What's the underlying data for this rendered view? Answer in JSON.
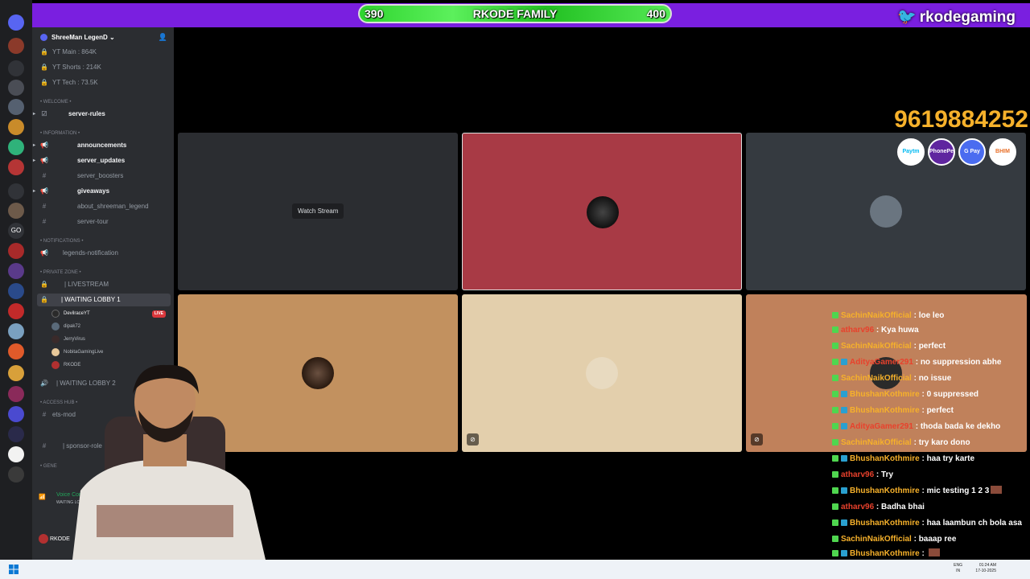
{
  "overlay": {
    "goal_current": "390",
    "goal_title": "RKODE FAMILY",
    "goal_target": "400",
    "brand": "rkodegaming",
    "phone": "9619884252",
    "payments": [
      "Paytm",
      "PhonePe",
      "G Pay",
      "BHIM"
    ]
  },
  "server": {
    "name": "ShreeMan LegenD",
    "stats": [
      "YT Main : 864K",
      "YT Shorts : 214K",
      "YT Tech : 73.5K"
    ]
  },
  "channels": {
    "cat_welcome": "• WELCOME •",
    "server_rules": "server-rules",
    "cat_information": "• INFORMATION •",
    "announcements": "announcements",
    "server_updates": "server_updates",
    "server_boosters": "server_boosters",
    "giveaways": "giveaways",
    "about": "about_shreeman_legend",
    "server_tour": "server-tour",
    "cat_notifications": "• NOTIFICATIONS •",
    "legends_notification": "legends-notification",
    "cat_private": "• PRIVATE ZONE •",
    "livestream": "| LIVESTREAM",
    "waiting_lobby_1": "| WAITING LOBBY 1",
    "waiting_lobby_2": "| WAITING LOBBY 2",
    "cat_access": "• ACCESS HUB •",
    "ets_mod": "ets-mod",
    "sponsor_role": "| sponsor-role",
    "cat_general": "• GENE"
  },
  "voice_users": [
    {
      "name": "DevilraceYT",
      "live": "LIVE"
    },
    {
      "name": "dipak72"
    },
    {
      "name": "JerryVirus"
    },
    {
      "name": "NobitaGamingLive"
    },
    {
      "name": "RKODE"
    }
  ],
  "voice_panel": {
    "status": "Voice Connected",
    "channel": "WAITING LOBBY",
    "user": "RKODE"
  },
  "stage": {
    "watch_stream": "Watch Stream"
  },
  "chat": [
    {
      "user": "SachinNaikOfficial",
      "text": "loe leo",
      "color": "#f6b12b"
    },
    {
      "user": "atharv96",
      "text": "Kya huwa",
      "color": "#e8412c"
    },
    {
      "user": "SachinNaikOfficial",
      "text": "perfect",
      "color": "#f6b12b"
    },
    {
      "user": "AdityaGamer291",
      "text": "no suppression abhe",
      "color": "#e8412c"
    },
    {
      "user": "SachinNaikOfficial",
      "text": "no issue",
      "color": "#f6b12b"
    },
    {
      "user": "BhushanKothmire",
      "text": "0 suppressed",
      "color": "#f6b12b"
    },
    {
      "user": "BhushanKothmire",
      "text": "perfect",
      "color": "#f6b12b"
    },
    {
      "user": "AdityaGamer291",
      "text": "thoda bada ke dekho",
      "color": "#e8412c"
    },
    {
      "user": "SachinNaikOfficial",
      "text": "try karo dono",
      "color": "#f6b12b"
    },
    {
      "user": "BhushanKothmire",
      "text": "haa try karte",
      "color": "#f6b12b"
    },
    {
      "user": "atharv96",
      "text": "Try",
      "color": "#e8412c"
    },
    {
      "user": "BhushanKothmire",
      "text": "mic testing 1 2 3",
      "color": "#f6b12b"
    },
    {
      "user": "atharv96",
      "text": "Badha bhai",
      "color": "#e8412c"
    },
    {
      "user": "BhushanKothmire",
      "text": "haa laambun ch bola asa",
      "color": "#f6b12b"
    },
    {
      "user": "SachinNaikOfficial",
      "text": "baaap ree",
      "color": "#f6b12b"
    },
    {
      "user": "BhushanKothmire",
      "text": "",
      "color": "#f6b12b"
    }
  ],
  "taskbar": {
    "lang_top": "ENG",
    "lang_bottom": "IN",
    "time": "01:24 AM",
    "date": "17-10-2025"
  },
  "colors": {
    "topbar": "#7a1fe0",
    "tile_red": "#a83a45",
    "tile_dark": "#2b2d31",
    "tile_slate": "#353a40",
    "tile_tan": "#c2915f",
    "tile_cream": "#e3cfac",
    "tile_copper": "#c0815b",
    "phone": "#f6b12b"
  }
}
